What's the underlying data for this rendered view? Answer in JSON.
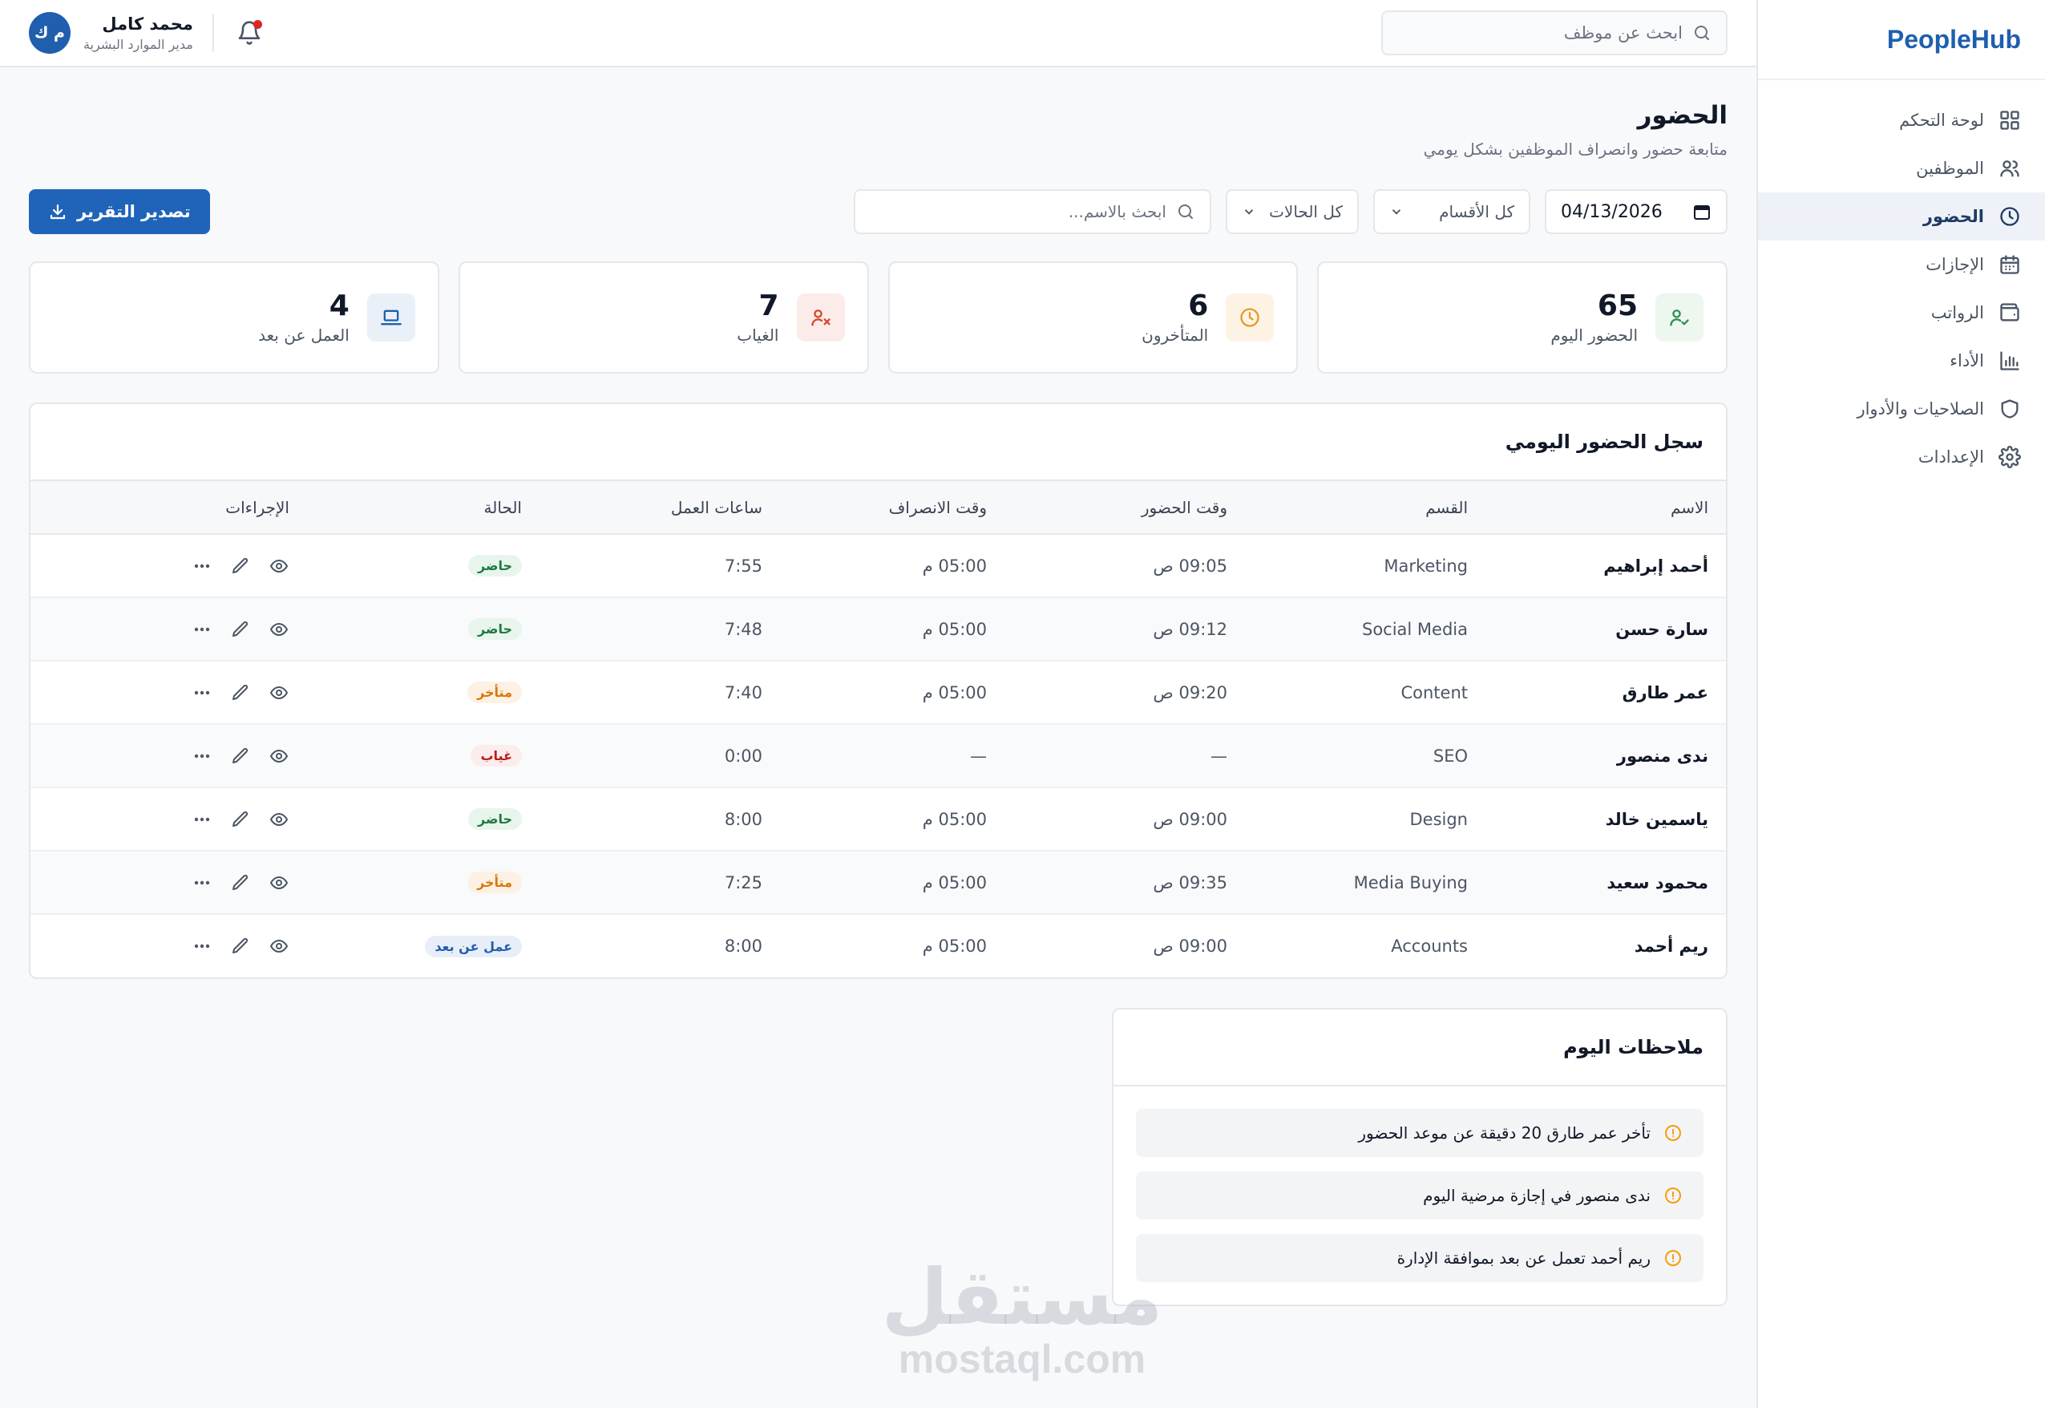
{
  "brand": "PeopleHub",
  "sidebar": {
    "items": [
      {
        "label": "لوحة التحكم"
      },
      {
        "label": "الموظفين"
      },
      {
        "label": "الحضور"
      },
      {
        "label": "الإجازات"
      },
      {
        "label": "الرواتب"
      },
      {
        "label": "الأداء"
      },
      {
        "label": "الصلاحيات والأدوار"
      },
      {
        "label": "الإعدادات"
      }
    ],
    "active_index": 2
  },
  "topbar": {
    "search_placeholder": "ابحث عن موظف",
    "user_name": "محمد كامل",
    "user_role": "مدير الموارد البشرية",
    "avatar_initials": "م ك"
  },
  "page": {
    "title": "الحضور",
    "subtitle": "متابعة حضور وانصراف الموظفين بشكل يومي"
  },
  "filters": {
    "date": "04/13/2026",
    "department": "كل الأقسام",
    "status": "كل الحالات",
    "name_placeholder": "ابحث بالاسم...",
    "export_label": "تصدير التقرير"
  },
  "stats": [
    {
      "value": "65",
      "label": "الحضور اليوم",
      "color": "#2f8f55",
      "bg": "#eef6f0"
    },
    {
      "value": "6",
      "label": "المتأخرون",
      "color": "#e59a2c",
      "bg": "#fdf3e4"
    },
    {
      "value": "7",
      "label": "الغياب",
      "color": "#d9472b",
      "bg": "#fbecea"
    },
    {
      "value": "4",
      "label": "العمل عن بعد",
      "color": "#1f5fae",
      "bg": "#eaf0f8"
    }
  ],
  "table": {
    "title": "سجل الحضور اليومي",
    "headers": {
      "name": "الاسم",
      "dept": "القسم",
      "in": "وقت الحضور",
      "out": "وقت الانصراف",
      "hours": "ساعات العمل",
      "status": "الحالة",
      "actions": "الإجراءات"
    },
    "rows": [
      {
        "name": "أحمد إبراهيم",
        "dept": "Marketing",
        "in": "09:05 ص",
        "out": "05:00 م",
        "hours": "7:55",
        "status": "حاضر"
      },
      {
        "name": "سارة حسن",
        "dept": "Social Media",
        "in": "09:12 ص",
        "out": "05:00 م",
        "hours": "7:48",
        "status": "حاضر"
      },
      {
        "name": "عمر طارق",
        "dept": "Content",
        "in": "09:20 ص",
        "out": "05:00 م",
        "hours": "7:40",
        "status": "متأخر"
      },
      {
        "name": "ندى منصور",
        "dept": "SEO",
        "in": "—",
        "out": "—",
        "hours": "0:00",
        "status": "غياب"
      },
      {
        "name": "ياسمين خالد",
        "dept": "Design",
        "in": "09:00 ص",
        "out": "05:00 م",
        "hours": "8:00",
        "status": "حاضر"
      },
      {
        "name": "محمود سعيد",
        "dept": "Media Buying",
        "in": "09:35 ص",
        "out": "05:00 م",
        "hours": "7:25",
        "status": "متأخر"
      },
      {
        "name": "ريم أحمد",
        "dept": "Accounts",
        "in": "09:00 ص",
        "out": "05:00 م",
        "hours": "8:00",
        "status": "عمل عن بعد"
      }
    ]
  },
  "notes": {
    "title": "ملاحظات اليوم",
    "items": [
      "تأخر عمر طارق 20 دقيقة عن موعد الحضور",
      "ندى منصور في إجازة مرضية اليوم",
      "ريم أحمد تعمل عن بعد بموافقة الإدارة"
    ]
  },
  "watermark": {
    "ar": "مستقل",
    "en": "mostaql.com"
  }
}
